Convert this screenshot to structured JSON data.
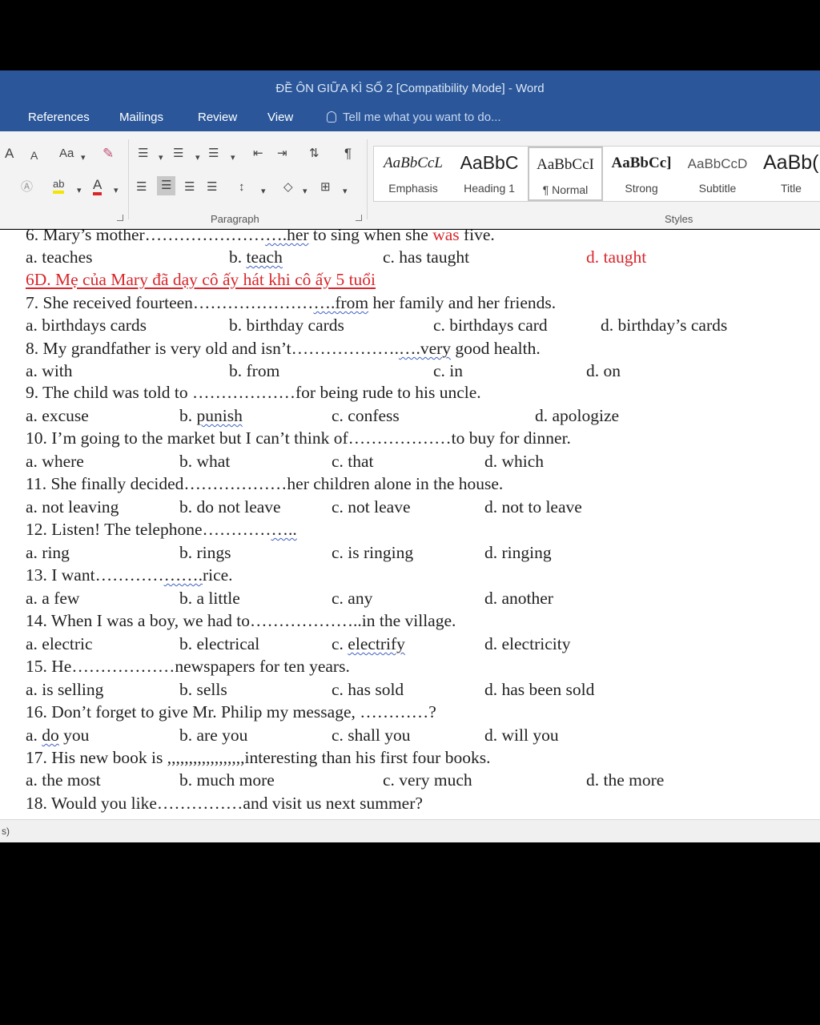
{
  "window": {
    "title": "ĐỀ ÔN GIỮA KÌ SỐ 2 [Compatibility Mode] - Word"
  },
  "ribbon_tabs": [
    "References",
    "Mailings",
    "Review",
    "View"
  ],
  "tell_me": "Tell me what you want to do...",
  "font_group": {
    "grow": "A",
    "shrink": "A",
    "change_case": "Aa",
    "highlight": "ab",
    "font_color": "A"
  },
  "paragraph": {
    "group_label": "Paragraph",
    "pilcrow": "¶"
  },
  "styles": {
    "group_label": "Styles",
    "items": [
      {
        "preview": "AaBbCcL",
        "name": "Emphasis"
      },
      {
        "preview": "AaBbC",
        "name": "Heading 1"
      },
      {
        "preview": "AaBbCcI",
        "name": "¶ Normal"
      },
      {
        "preview": "AaBbCc]",
        "name": "Strong"
      },
      {
        "preview": "AaBbCcD",
        "name": "Subtitle"
      },
      {
        "preview": "AaBb(",
        "name": "Title"
      }
    ]
  },
  "document": {
    "q6_stem_a": "6. Mary’s mother…………………",
    "q6_stem_ul": "….her",
    "q6_stem_b": " to sing when she ",
    "q6_stem_red": "was",
    "q6_stem_c": " five.",
    "q6_opts": [
      "a. teaches",
      "b. teach",
      "c. has taught",
      "d. taught"
    ],
    "q6_note": "6D. Mẹ của Mary đã dạy cô ấy hát khi cô ấy 5 tuổi",
    "q7_a": "7. She received fourteen…………………",
    "q7_ul": "….from",
    "q7_b": " her family and her friends.",
    "q7_opts": [
      "a. birthdays cards",
      "b. birthday cards",
      "c. birthdays card",
      "d. birthday’s cards"
    ],
    "q8_a": "8. My grandfather is very old and isn’t……………….",
    "q8_ul": "….very",
    "q8_b": " good health.",
    "q8_opts": [
      "a. with",
      "b. from",
      "c. in",
      "d. on"
    ],
    "q9": "9. The child was told to ………………for being rude to his uncle.",
    "q9_opts": [
      "a. excuse",
      "b. punish",
      "c. confess",
      "d. apologize"
    ],
    "q10": "10. I’m going to the market but I can’t think of………………to buy for dinner.",
    "q10_opts": [
      "a. where",
      "b. what",
      "c. that",
      "d. which"
    ],
    "q11": "11. She finally decided………………her children alone in the house.",
    "q11_opts": [
      "a. not leaving",
      "b. do not leave",
      "c. not leave",
      "d. not to leave"
    ],
    "q12_a": "12. Listen! The telephone…………",
    "q12_ul": "…..",
    "q12_opts": [
      "a. ring",
      "b. rings",
      "c. is ringing",
      "d. ringing"
    ],
    "q13_a": "13. I want…………",
    "q13_ul": "…….",
    "q13_b": "rice.",
    "q13_opts": [
      "a. a few",
      "b. a little",
      "c. any",
      "d. another"
    ],
    "q14": "14. When I was a boy, we had to………………..in the village.",
    "q14_opts": [
      "a. electric",
      "b. electrical",
      "c. electrify",
      "d. electricity"
    ],
    "q15": "15. He………………newspapers for ten years.",
    "q15_opts": [
      "a. is selling",
      "b. sells",
      "c. has sold",
      "d. has been sold"
    ],
    "q16": "16. Don’t forget to give Mr. Philip my message, …………?",
    "q16_opts": [
      "a. do you",
      "b. are you",
      "c. shall you",
      "d. will you"
    ],
    "q17": "17. His new book is ,,,,,,,,,,,,,,,,,,interesting than his first four books.",
    "q17_opts": [
      "a. the most",
      "b. much more",
      "c. very much",
      "d. the more"
    ],
    "q18": "18. Would you like……………and visit us next summer?"
  },
  "status": {
    "fragment": "s)"
  },
  "colors": {
    "title_blue": "#2b579a",
    "answer_red": "#d8262b"
  }
}
